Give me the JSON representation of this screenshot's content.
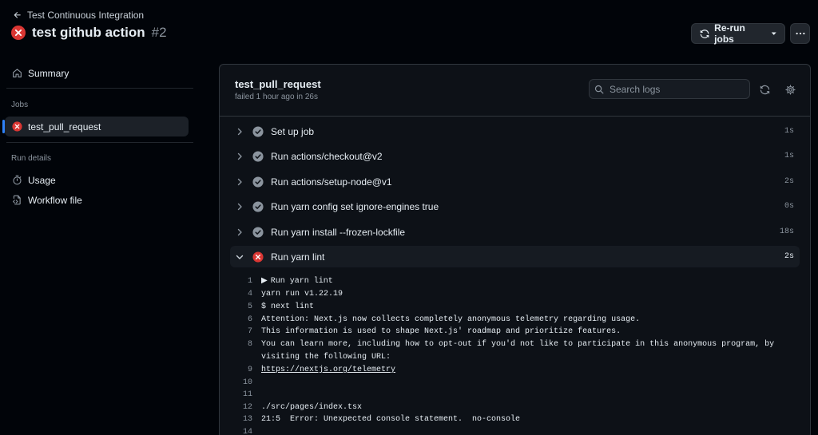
{
  "header": {
    "back_label": "Test Continuous Integration",
    "run_name": "test github action",
    "run_number": "#2",
    "rerun_label": "Re-run jobs"
  },
  "sidebar": {
    "summary_label": "Summary",
    "jobs_heading": "Jobs",
    "active_job": "test_pull_request",
    "run_details_heading": "Run details",
    "usage_label": "Usage",
    "workflow_file_label": "Workflow file"
  },
  "job": {
    "title": "test_pull_request",
    "meta": "failed 1 hour ago in 26s",
    "search_placeholder": "Search logs"
  },
  "steps": [
    {
      "label": "Set up job",
      "duration": "1s",
      "status": "success"
    },
    {
      "label": "Run actions/checkout@v2",
      "duration": "1s",
      "status": "success"
    },
    {
      "label": "Run actions/setup-node@v1",
      "duration": "2s",
      "status": "success"
    },
    {
      "label": "Run yarn config set ignore-engines true",
      "duration": "0s",
      "status": "success"
    },
    {
      "label": "Run yarn install --frozen-lockfile",
      "duration": "18s",
      "status": "success"
    },
    {
      "label": "Run yarn lint",
      "duration": "2s",
      "status": "failure"
    }
  ],
  "log": [
    {
      "n": "1",
      "text": "Run yarn lint"
    },
    {
      "n": "4",
      "text": "yarn run v1.22.19"
    },
    {
      "n": "5",
      "text": "$ next lint"
    },
    {
      "n": "6",
      "text": "Attention: Next.js now collects completely anonymous telemetry regarding usage."
    },
    {
      "n": "7",
      "text": "This information is used to shape Next.js' roadmap and prioritize features."
    },
    {
      "n": "8",
      "text": "You can learn more, including how to opt-out if you'd not like to participate in this anonymous program, by"
    },
    {
      "n": "",
      "text": "visiting the following URL:"
    },
    {
      "n": "9",
      "text": "https://nextjs.org/telemetry"
    },
    {
      "n": "10",
      "text": ""
    },
    {
      "n": "11",
      "text": ""
    },
    {
      "n": "12",
      "text": "./src/pages/index.tsx"
    },
    {
      "n": "13",
      "text": "21:5  Error: Unexpected console statement.  no-console"
    },
    {
      "n": "14",
      "text": ""
    }
  ],
  "colors": {
    "success": "#8b949e",
    "failure": "#da3633",
    "accent": "#2f81f7"
  }
}
